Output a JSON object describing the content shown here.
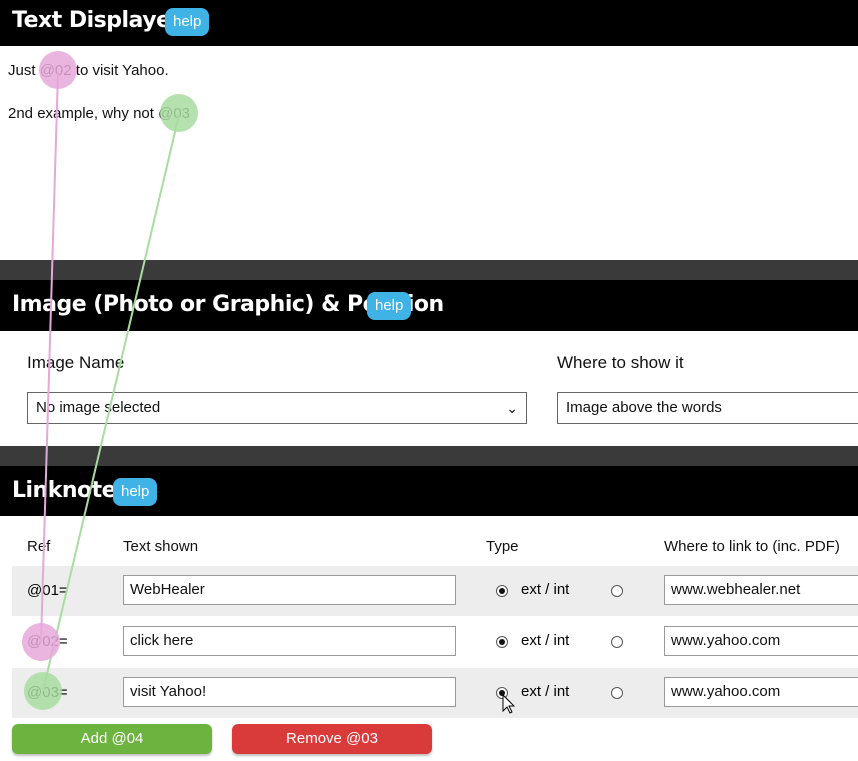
{
  "text_displayed": {
    "title": "Text Displayed",
    "help_label": "help",
    "line1_before": "Just ",
    "line1_ref": "@02",
    "line1_after": " to visit Yahoo.",
    "line2_before": "2nd example, why not ",
    "line2_ref": "@03"
  },
  "image_section": {
    "title": "Image (Photo or Graphic) & Position",
    "help_label": "help",
    "image_name_label": "Image Name",
    "image_name_value": "No image selected",
    "where_label": "Where to show it",
    "where_value": "Image above the words"
  },
  "linknotes": {
    "title": "Linknotes",
    "help_label": "help",
    "headers": {
      "ref": "Ref",
      "text": "Text shown",
      "type": "Type",
      "link": "Where to link to (inc. PDF)"
    },
    "rows": [
      {
        "ref": "@01=",
        "text": "WebHealer",
        "type": "ext / int",
        "type_selected": "ext",
        "link": "www.webhealer.net"
      },
      {
        "ref": "@02=",
        "text": "click here",
        "type": "ext / int",
        "type_selected": "ext",
        "link": "www.yahoo.com"
      },
      {
        "ref": "@03=",
        "text": "visit Yahoo!",
        "type": "ext / int",
        "type_selected": "ext",
        "link": "www.yahoo.com"
      }
    ],
    "add_button": "Add @04",
    "remove_button": "Remove @03"
  },
  "colors": {
    "help_blue": "#3fb3e6",
    "add_green": "#6db33f",
    "remove_red": "#d93a3a",
    "marker_pink": "#e6a8d8",
    "marker_green": "#a8dca0"
  }
}
